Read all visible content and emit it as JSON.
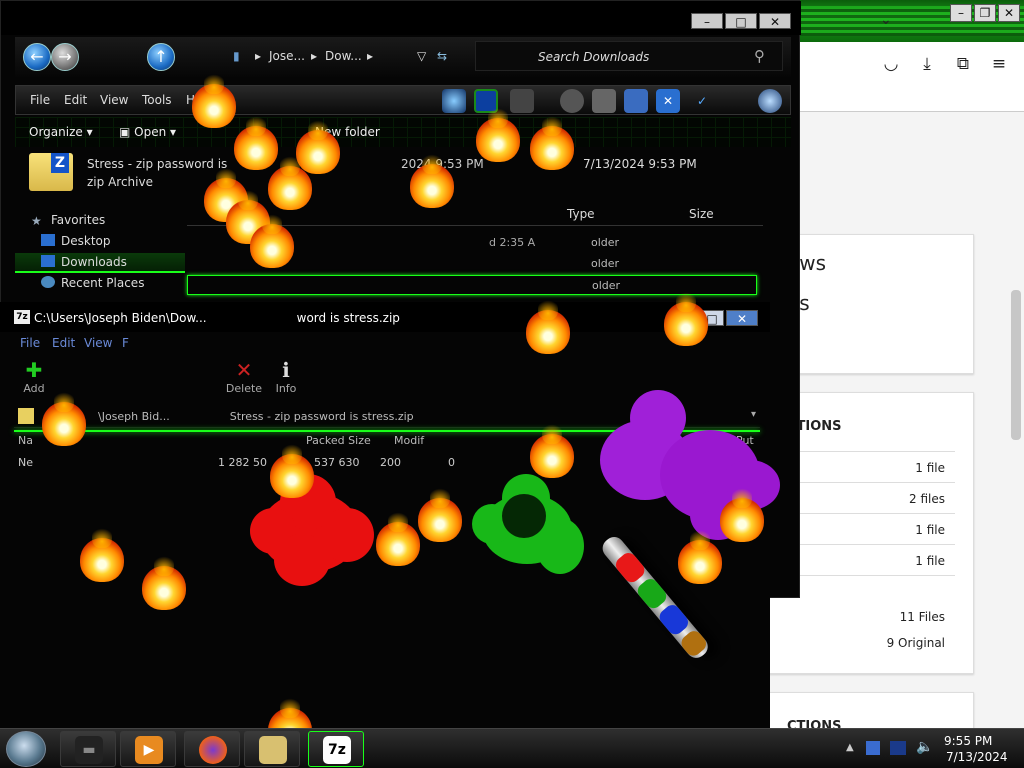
{
  "explorer": {
    "breadcrumb": [
      "Jose...",
      "Dow...",
      ""
    ],
    "search_placeholder": "Search Downloads",
    "menu": [
      "File",
      "Edit",
      "View",
      "Tools",
      "H"
    ],
    "commands": {
      "organize": "Organize",
      "open": "Open",
      "new_folder": "New folder"
    },
    "details": {
      "file_name": "Stress - zip password is",
      "file_type": "zip Archive",
      "modified_partial": "2024 9:53 PM",
      "created": "7/13/2024 9:53 PM"
    },
    "sidebar": [
      "Favorites",
      "Desktop",
      "Downloads",
      "Recent Places"
    ],
    "columns": [
      "Type",
      "Size"
    ],
    "rows": [
      {
        "type_text": "older"
      },
      {
        "type_text": "older"
      },
      {
        "type_text": "older"
      }
    ],
    "row_date_partial": "d 2:35 A"
  },
  "zip": {
    "title": "C:\\Users\\Joseph Biden\\Dow...",
    "title_tail": "word is stress.zip",
    "menu": [
      "File",
      "Edit",
      "View",
      "F"
    ],
    "tools": [
      "Add",
      "Delete",
      "Info"
    ],
    "address": "\\Joseph Bid...",
    "address_tail": "Stress - zip password is stress.zip",
    "columns": [
      "Na",
      "Packed Size",
      "Modif",
      "Put"
    ],
    "row": {
      "name": "Ne",
      "size": "1 282 50",
      "packed": "537 630",
      "modified": "200",
      "extra": "0"
    }
  },
  "browser": {
    "headings": [
      "ews",
      "es"
    ],
    "options_heading": "PTIONS",
    "counts": [
      "1 file",
      "2 files",
      "1 file",
      "1 file"
    ],
    "summary": [
      "11 Files",
      "9 Original"
    ],
    "bottom_heading": "CTIONS"
  },
  "taskbar": {
    "time": "9:55 PM",
    "date": "7/13/2024",
    "zip_label": "7z"
  },
  "colors": {
    "neon_green": "#19ff19",
    "titlebar_green": "#1a9a1a",
    "fire_orange": "#ff8a00"
  }
}
